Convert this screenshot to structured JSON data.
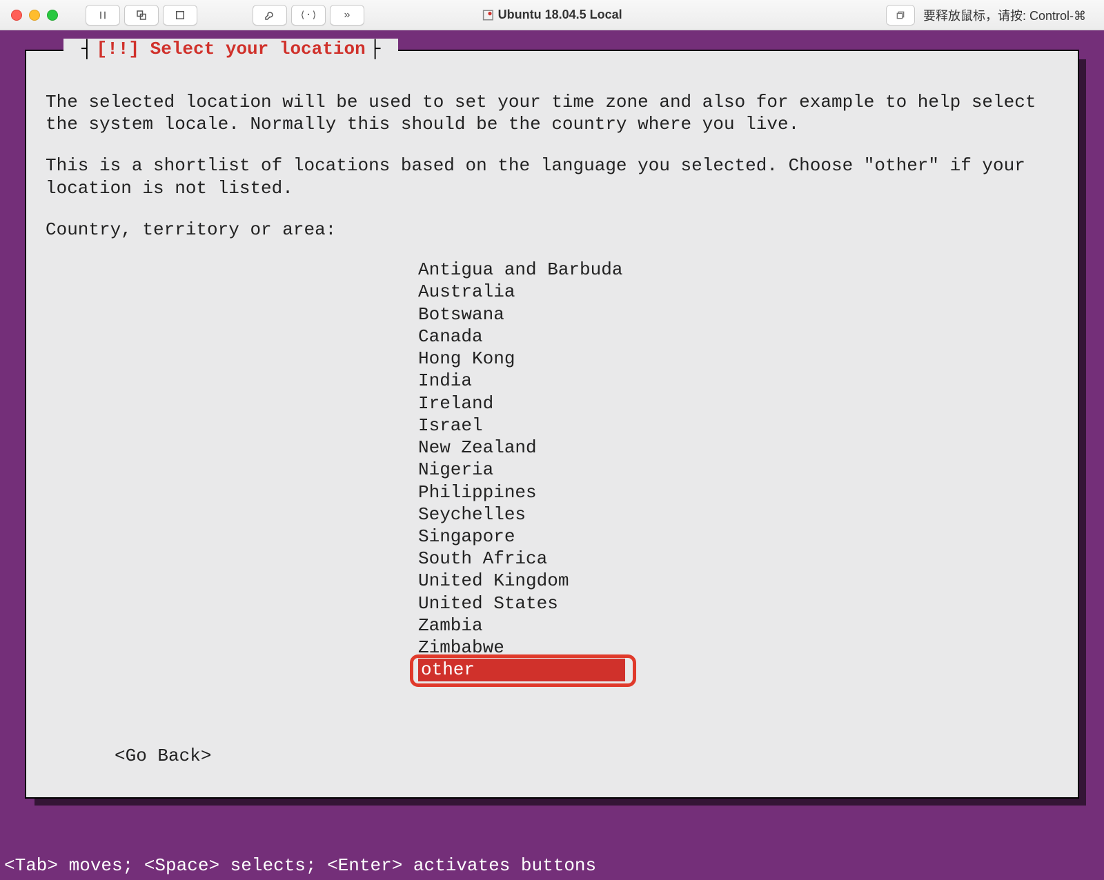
{
  "titlebar": {
    "window_title": "Ubuntu 18.04.5 Local",
    "mouse_hint": "要释放鼠标，请按: Control-⌘"
  },
  "installer": {
    "panel_title": "[!!] Select your location",
    "paragraph1": "The selected location will be used to set your time zone and also for example to help select the system locale. Normally this should be the country where you live.",
    "paragraph2": "This is a shortlist of locations based on the language you selected. Choose \"other\" if your location is not listed.",
    "prompt_label": "Country, territory or area:",
    "countries": [
      "Antigua and Barbuda",
      "Australia",
      "Botswana",
      "Canada",
      "Hong Kong",
      "India",
      "Ireland",
      "Israel",
      "New Zealand",
      "Nigeria",
      "Philippines",
      "Seychelles",
      "Singapore",
      "South Africa",
      "United Kingdom",
      "United States",
      "Zambia",
      "Zimbabwe",
      "other"
    ],
    "selected_index": 18,
    "go_back_label": "<Go Back>",
    "footer_hint": "<Tab> moves; <Space> selects; <Enter> activates buttons"
  }
}
